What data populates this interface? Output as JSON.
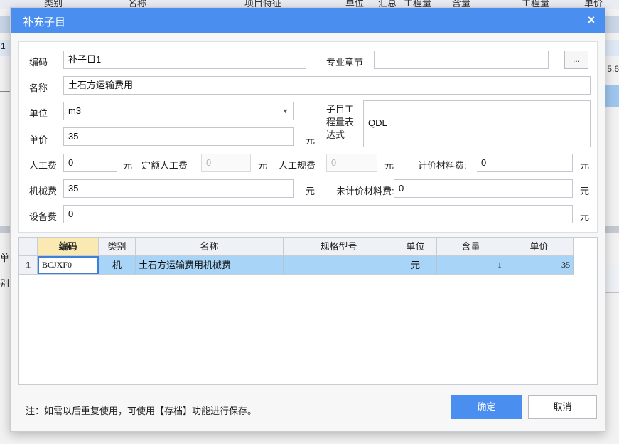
{
  "background": {
    "header_fragments": [
      "类别",
      "名称",
      "项目特征",
      "单位",
      "汇总",
      "工程量",
      "含量",
      "工程量",
      "单价"
    ],
    "row_number": "1",
    "right_fragment": "5.6",
    "left_frag1": "单",
    "left_frag2": "别"
  },
  "dialog": {
    "title": "补充子目",
    "close_symbol": "×",
    "colors": {
      "title_bg": "#4a8ef0",
      "grid_selected_row": "#a8d4f8",
      "active_header": "#fbe9b2"
    }
  },
  "form": {
    "code_label": "编码",
    "code_value": "补子目1",
    "chapter_label": "专业章节",
    "chapter_value": "",
    "chapter_button": "...",
    "name_label": "名称",
    "name_value": "土石方运输费用",
    "unit_label": "单位",
    "unit_value": "m3",
    "expr_label": "子目工程量表达式",
    "expr_value": "QDL",
    "price_label": "单价",
    "price_value": "35",
    "yuan": "元",
    "labor_label": "人工费",
    "labor_value": "0",
    "quota_labor_label": "定额人工费",
    "quota_labor_value": "0",
    "labor_reg_label": "人工规费",
    "labor_reg_value": "0",
    "priced_material_label": "计价材料费:",
    "priced_material_value": "0",
    "machine_label": "机械费",
    "machine_value": "35",
    "unpriced_material_label": "未计价材料费:",
    "unpriced_material_value": "0",
    "equipment_label": "设备费",
    "equipment_value": "0"
  },
  "grid": {
    "columns": [
      "",
      "编码",
      "类别",
      "名称",
      "规格型号",
      "单位",
      "含量",
      "单价"
    ],
    "rows": [
      {
        "num": "1",
        "code": "BCJXF0",
        "category": "机",
        "name": "土石方运输费用机械费",
        "spec": "",
        "unit": "元",
        "content": "1",
        "price": "35"
      }
    ]
  },
  "footer": {
    "note": "注：如需以后重复使用，可使用【存档】功能进行保存。",
    "ok_label": "确定",
    "cancel_label": "取消"
  }
}
